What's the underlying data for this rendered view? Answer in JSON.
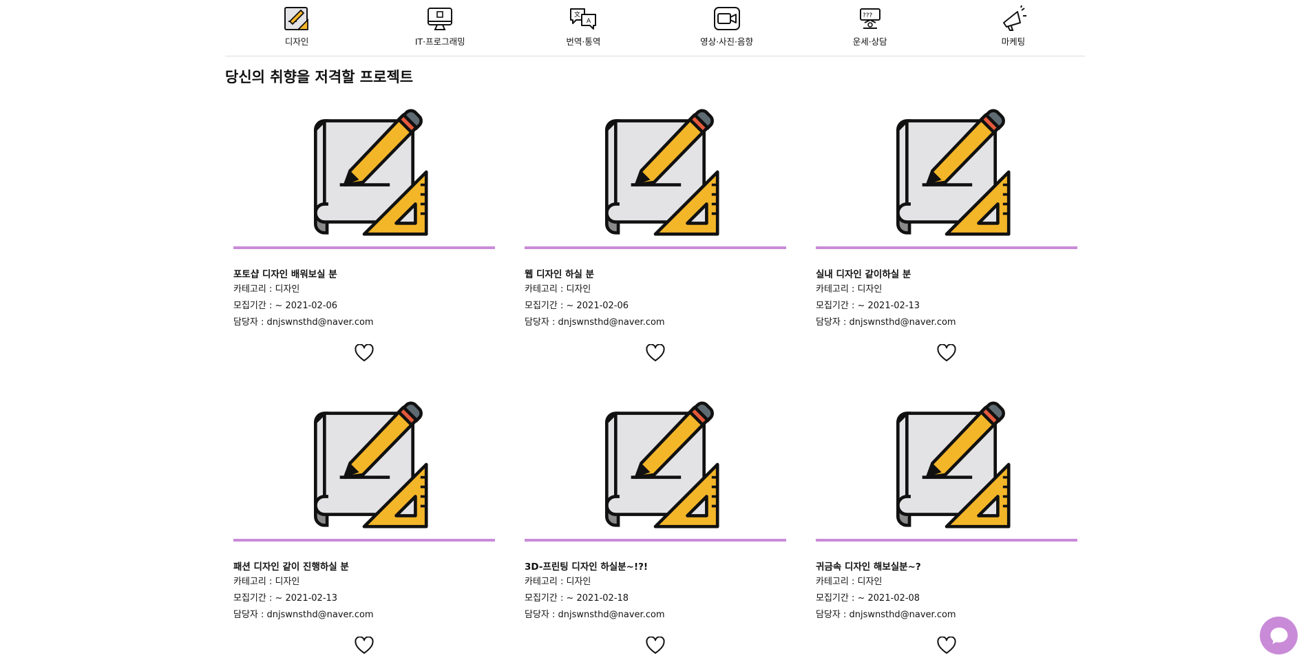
{
  "categories": [
    {
      "label": "디자인",
      "icon": "design-icon"
    },
    {
      "label": "IT·프로그래밍",
      "icon": "computer-icon"
    },
    {
      "label": "번역·통역",
      "icon": "translate-icon"
    },
    {
      "label": "영상·사진·음향",
      "icon": "video-camera-icon"
    },
    {
      "label": "운세·상담",
      "icon": "fortune-icon"
    },
    {
      "label": "마케팅",
      "icon": "megaphone-icon"
    }
  ],
  "section_title": "당신의 취향을 저격할 프로젝트",
  "projects": [
    {
      "title": "포토샵 디자인 배워보실 분",
      "category": "카테고리 : 디자인",
      "period": "모집기간 : ~ 2021-02-06",
      "manager": "담당자 : dnjswnsthd@naver.com"
    },
    {
      "title": "웹 디자인 하실 분",
      "category": "카테고리 : 디자인",
      "period": "모집기간 : ~ 2021-02-06",
      "manager": "담당자 : dnjswnsthd@naver.com"
    },
    {
      "title": "실내 디자인 같이하실 분",
      "category": "카테고리 : 디자인",
      "period": "모집기간 : ~ 2021-02-13",
      "manager": "담당자 : dnjswnsthd@naver.com"
    },
    {
      "title": "패션 디자인 같이 진행하실 분",
      "category": "카테고리 : 디자인",
      "period": "모집기간 : ~ 2021-02-13",
      "manager": "담당자 : dnjswnsthd@naver.com"
    },
    {
      "title": "3D-프린팅 디자인 하실분~!?!",
      "category": "카테고리 : 디자인",
      "period": "모집기간 : ~ 2021-02-18",
      "manager": "담당자 : dnjswnsthd@naver.com"
    },
    {
      "title": "귀금속 디자인 해보실분~?",
      "category": "카테고리 : 디자인",
      "period": "모집기간 : ~ 2021-02-08",
      "manager": "담당자 : dnjswnsthd@naver.com"
    }
  ],
  "colors": {
    "accent": "#c98bd8",
    "divider": "#dcdcdc"
  },
  "icons": {
    "card_image": "design-drawing-icon",
    "like": "heart-icon",
    "chat": "chat-bubble-icon"
  }
}
